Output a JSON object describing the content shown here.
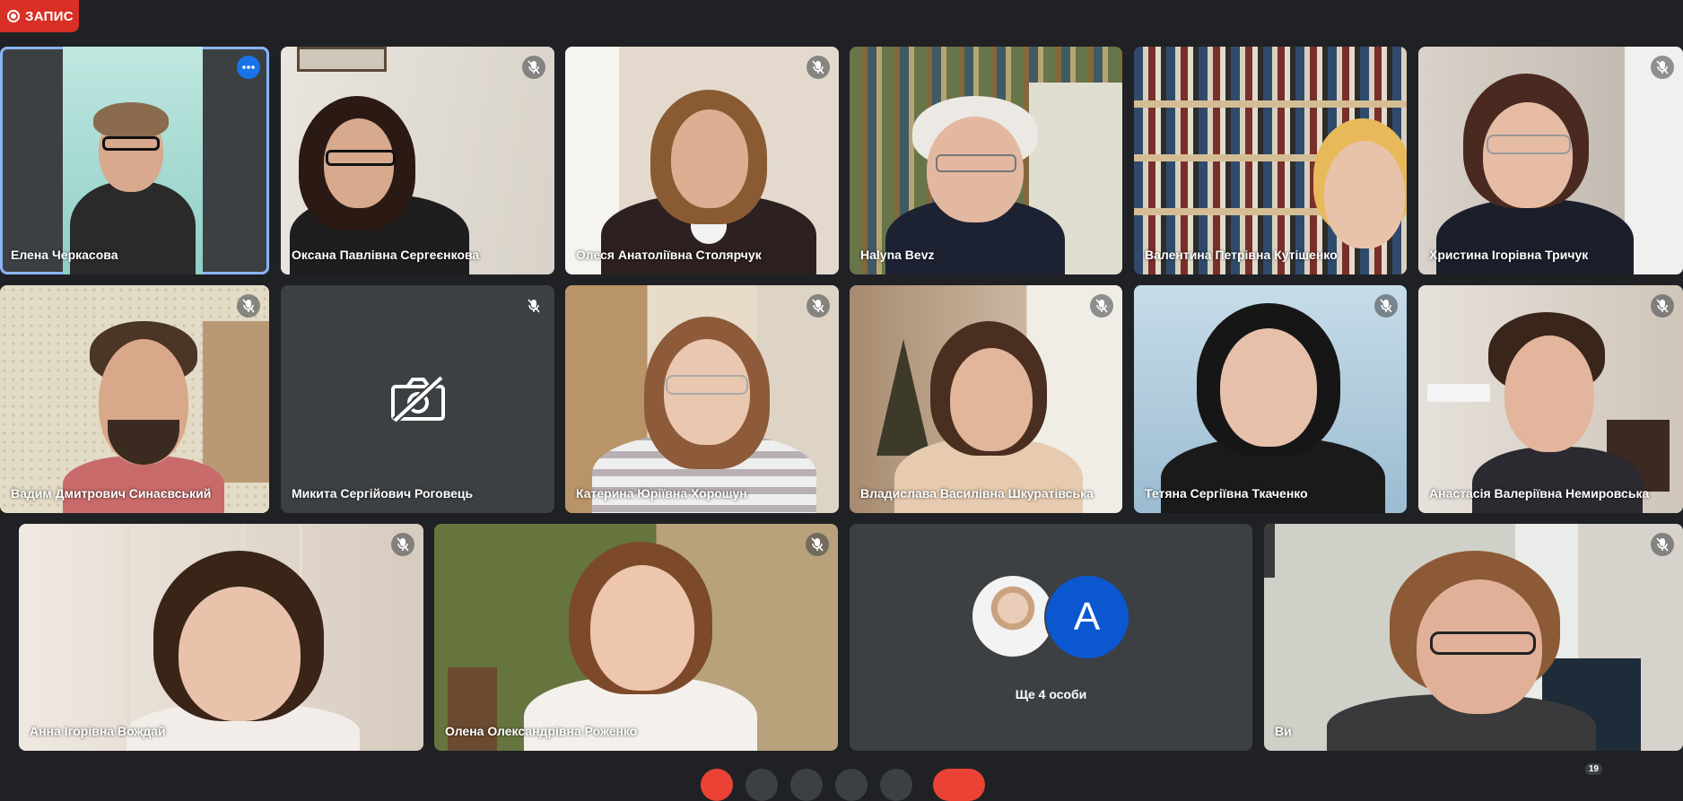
{
  "recording": {
    "label": "ЗАПИС",
    "color": "#d93025"
  },
  "accent": "#8ab4f8",
  "tiles": [
    {
      "name": "Елена Черкасова",
      "active": true
    },
    {
      "name": "Оксана Павлівна Сергеєнкова"
    },
    {
      "name": "Олеся Анатоліївна Столярчук"
    },
    {
      "name": "Halyna Bevz"
    },
    {
      "name": "Валентина Петрівна Кутішенко"
    },
    {
      "name": "Христина Ігорівна Тричук"
    },
    {
      "name": "Вадим Дмитрович Синаєвський"
    },
    {
      "name": "Микита Сергійович Роговець",
      "camera_off": true
    },
    {
      "name": "Катерина Юріївна Хорошун"
    },
    {
      "name": "Владислава Василівна Шкуратівська"
    },
    {
      "name": "Тетяна Сергіївна Ткаченко"
    },
    {
      "name": "Анастасія Валеріївна Немировська"
    },
    {
      "name": "Анна Ігорівна Вождай"
    },
    {
      "name": "Олена Олександрівна Роженко"
    },
    {
      "name": "Ви"
    }
  ],
  "others": {
    "label": "Ще 4 особи",
    "avatar_letter": "A"
  },
  "participant_count": "19",
  "icons": {
    "mic_off": "mic-off-icon",
    "more": "more-options-icon",
    "camera_off": "camera-off-icon",
    "record": "record-icon"
  }
}
